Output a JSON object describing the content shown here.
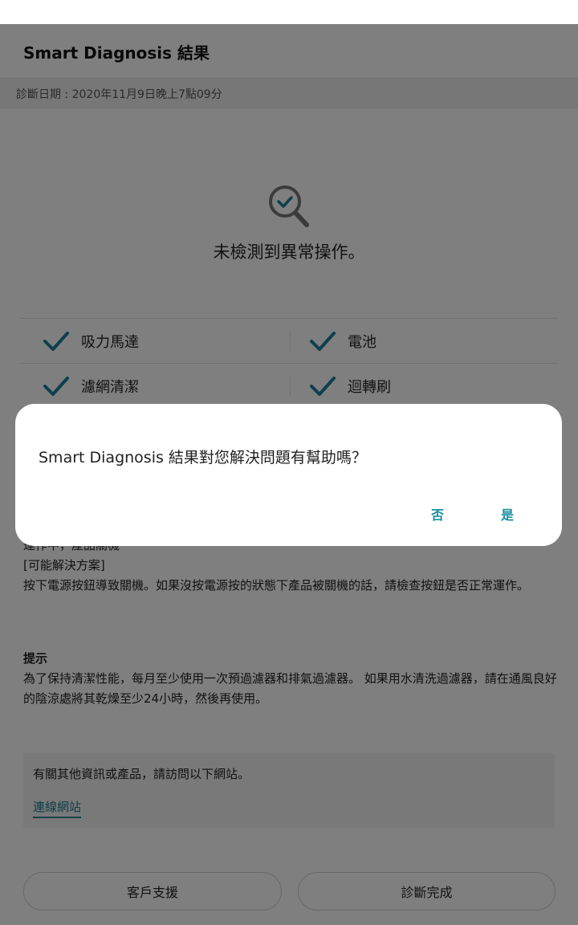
{
  "header": {
    "title": "Smart Diagnosis 結果"
  },
  "diagnosis_date": "診斷日期 : 2020年11月9日晚上7點09分",
  "result": {
    "icon": "magnifier-check-icon",
    "message": "未檢測到異常操作。"
  },
  "checks": [
    {
      "label": "吸力馬達",
      "status": "ok"
    },
    {
      "label": "電池",
      "status": "ok"
    },
    {
      "label": "濾網清潔",
      "status": "ok"
    },
    {
      "label": "迴轉刷",
      "status": "ok"
    }
  ],
  "troubleshoot": {
    "partial_line": "運作中，產品關機",
    "solution_heading": "[可能解決方案]",
    "solution_text": "按下電源按鈕導致關機。如果沒按電源按的狀態下產品被關機的話，請檢查按鈕是否正常運作。"
  },
  "tip": {
    "heading": "提示",
    "text": "為了保持清潔性能，每月至少使用一次預過濾器和排氣過濾器。 如果用水清洗過濾器，請在通風良好的陰涼處將其乾燥至少24小時，然後再使用。"
  },
  "info_box": {
    "text": "有關其他資訊或產品，請訪問以下網站。",
    "link_label": "連線網站"
  },
  "buttons": {
    "support": "客戶支援",
    "done": "診斷完成"
  },
  "dialog": {
    "question": "Smart Diagnosis 結果對您解決問題有幫助嗎？",
    "no": "否",
    "yes": "是"
  },
  "colors": {
    "accent": "#1a8fa0",
    "check": "#1a7f9a"
  }
}
